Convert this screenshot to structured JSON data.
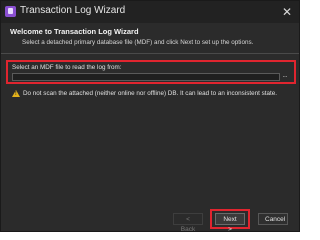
{
  "window": {
    "title": "Transaction Log Wizard",
    "close_glyph": "✕",
    "app_icon": "wizard-app-icon"
  },
  "header": {
    "title": "Welcome to Transaction Log Wizard",
    "subtitle": "Select a detached primary database file (MDF) and click Next to set up the options."
  },
  "mdf": {
    "label": "Select an MDF file to read the log from:",
    "value": "",
    "placeholder": "",
    "browse_label": "..."
  },
  "warning": {
    "icon": "warning-icon",
    "text": "Do not scan the attached (neither online nor offline) DB. It can lead to an inconsistent state."
  },
  "footer": {
    "back_label": "< Back",
    "next_label": "Next >",
    "cancel_label": "Cancel"
  },
  "colors": {
    "background": "#2b2b2b",
    "highlight": "#e0252f",
    "warning": "#e3b21b",
    "app_icon": "#8a4fd1"
  }
}
